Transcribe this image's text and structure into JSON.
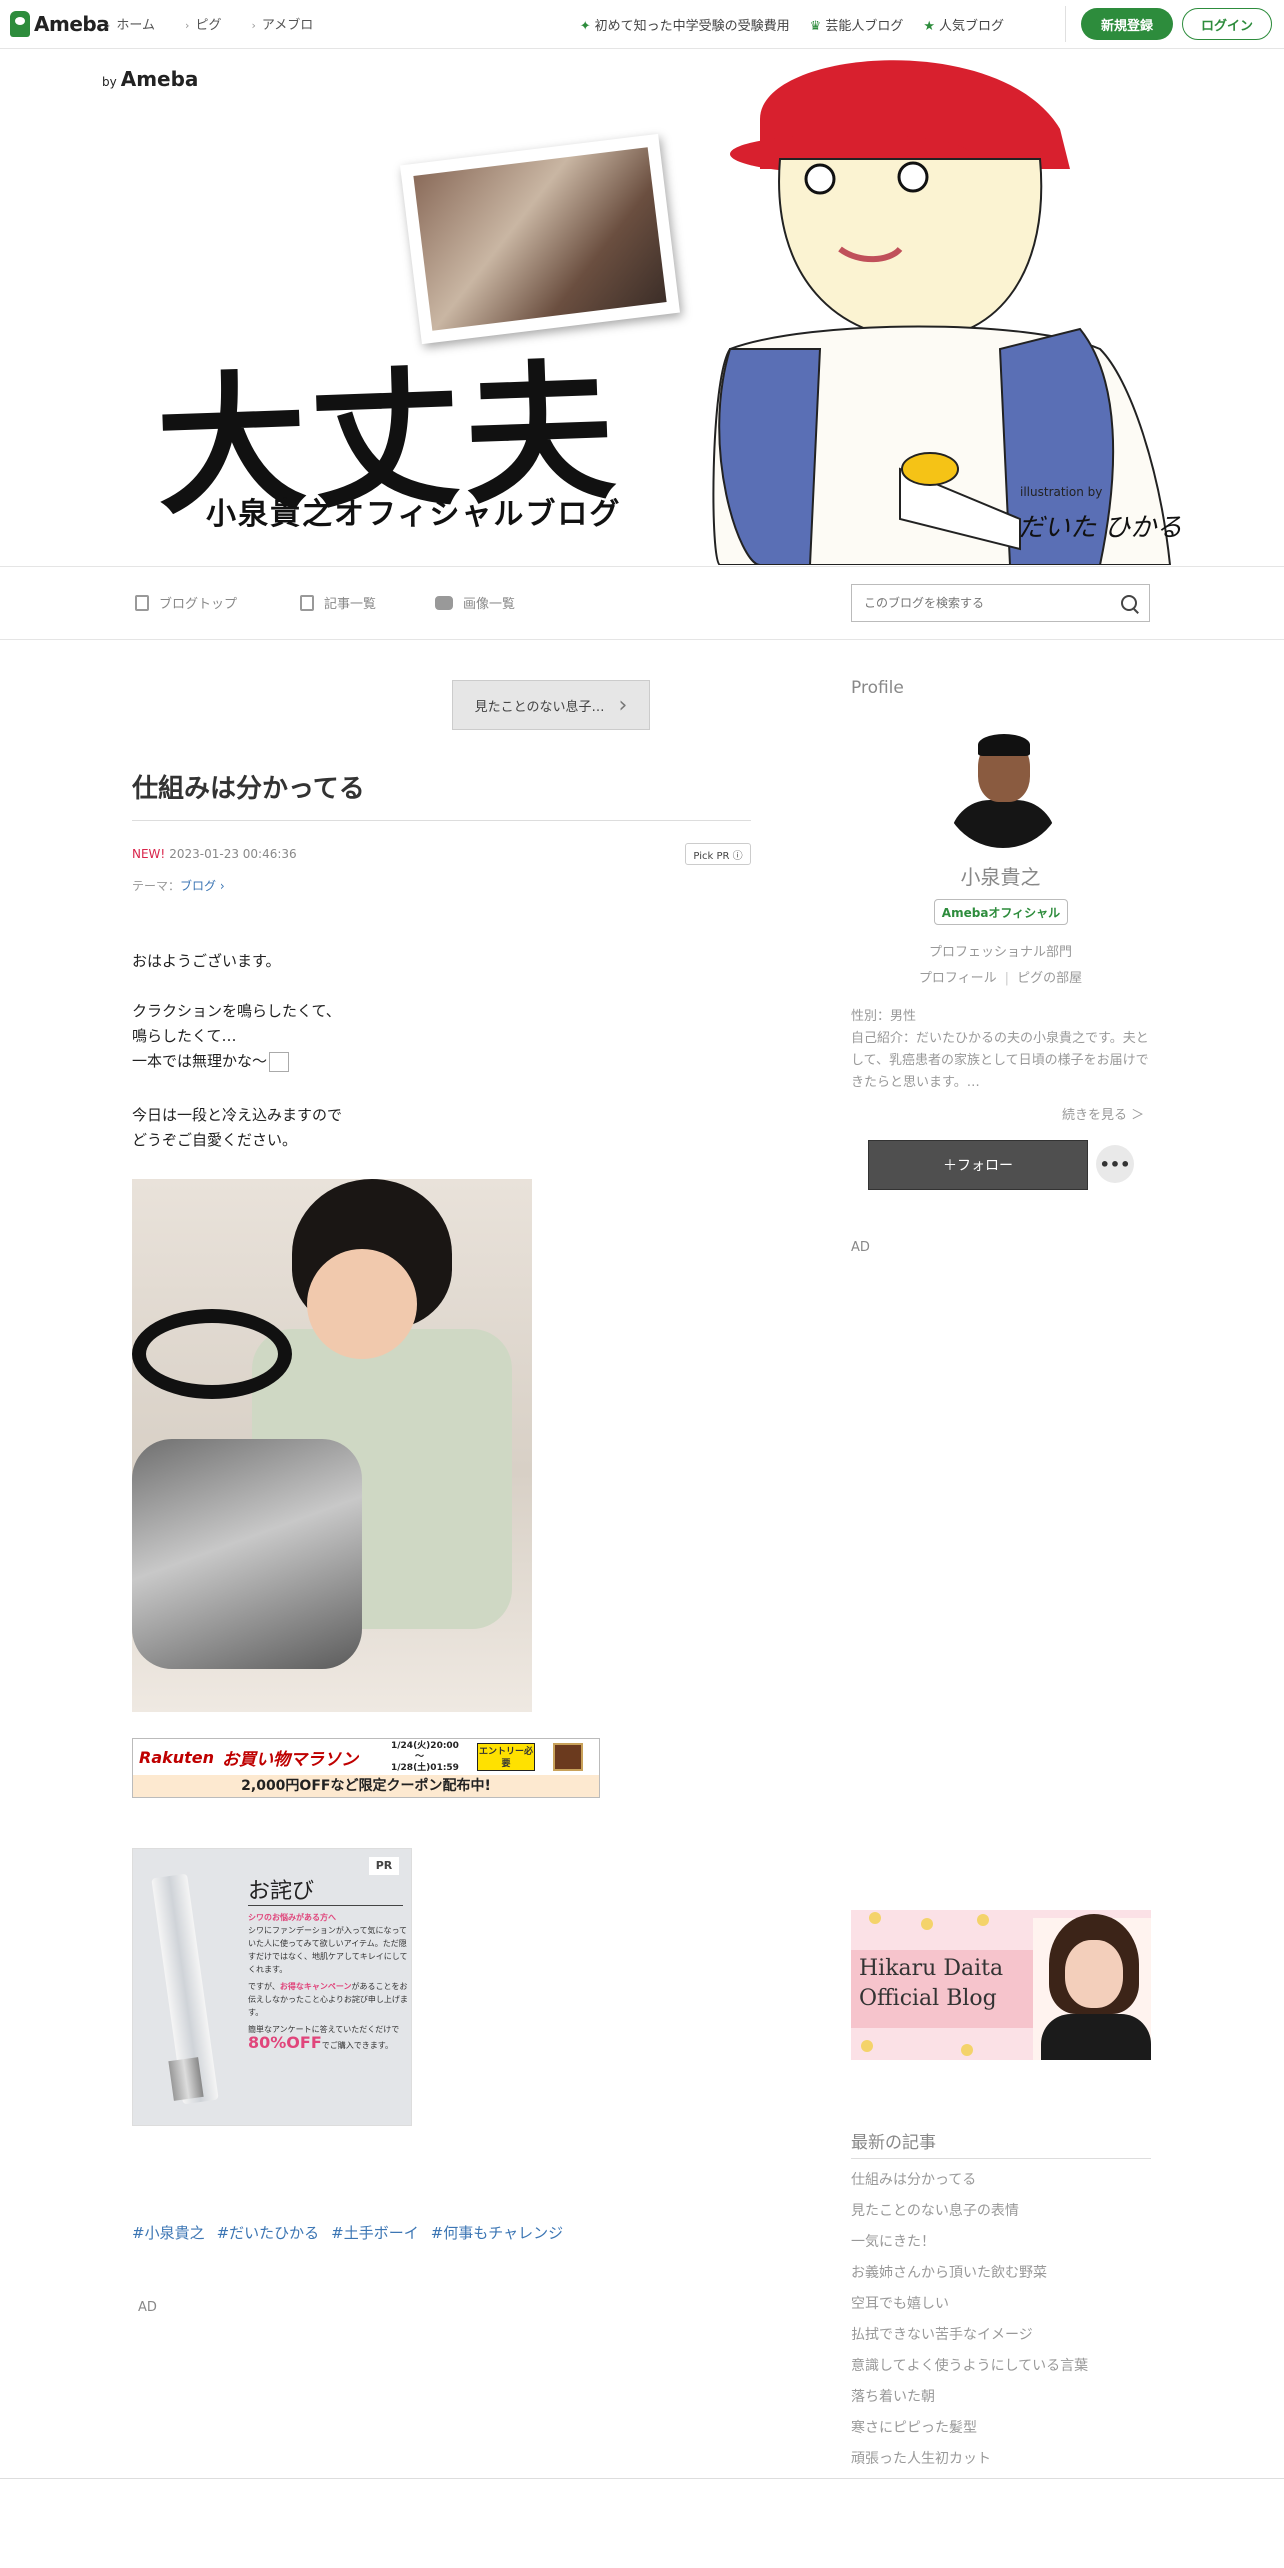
{
  "topnav": {
    "logo": "Ameba",
    "links": [
      "ホーム",
      "ピグ",
      "アメブロ"
    ],
    "right_links": [
      "初めて知った中学受験の受験費用",
      "芸能人ブログ",
      "人気ブログ"
    ],
    "register": "新規登録",
    "login": "ログイン"
  },
  "header": {
    "by": "by",
    "brand": "Ameba",
    "title": "大丈夫",
    "subtitle": "小泉貴之オフィシャルブログ",
    "illustration_credit": "illustration by",
    "illustrator": "だいた ひかる"
  },
  "subnav": {
    "items": [
      "ブログトップ",
      "記事一覧",
      "画像一覧"
    ],
    "search_placeholder": "このブログを検索する"
  },
  "article": {
    "prev_button": "見たことのない息子…",
    "title": "仕組みは分かってる",
    "new_label": "NEW!",
    "datetime": "2023-01-23 00:46:36",
    "pick_pr": "Pick PR ⓘ",
    "theme_label": "テーマ：",
    "theme_value": "ブログ",
    "paragraphs": [
      "おはようございます。",
      "クラクションを鳴らしたくて、",
      "鳴らしたくて…",
      "一本では無理かな〜",
      "今日は一段と冷え込みますので",
      "どうぞご自愛ください。"
    ],
    "hashtags": [
      "#小泉貴之",
      "#だいたひかる",
      "#土手ボーイ",
      "#何事もチャレンジ"
    ],
    "ad_label": "AD"
  },
  "rakuten_ad": {
    "logo": "Rakuten",
    "campaign": "お買い物マラソン",
    "date_start": "1/24(火)20:00",
    "date_sep": "〜",
    "date_end": "1/28(土)01:59",
    "entry": "エントリー必要",
    "offer": "2,000円OFFなど限定クーポン配布中!"
  },
  "pr_ad": {
    "badge": "PR",
    "title": "お詫び",
    "line1": "シワのお悩みがある方へ",
    "body": "シワにファンデーションが入って気になっていた人に使ってみて欲しいアイテム。ただ隠すだけではなく、地肌ケアしてキレイにしてくれます。",
    "line2a": "ですが、",
    "line2b": "お得なキャンペーン",
    "line2c": "があることをお伝えしなかったこと心よりお詫び申し上げます。",
    "line3": "簡単なアンケートに答えていただくだけで",
    "discount": "80%OFF",
    "line4": "でご購入できます。"
  },
  "sidebar": {
    "profile_heading": "Profile",
    "name": "小泉貴之",
    "official_badge": "Amebaオフィシャル",
    "department": "プロフェッショナル部門",
    "link_profile": "プロフィール",
    "link_pig": "ピグの部屋",
    "gender": "性別：男性",
    "intro": "自己紹介：だいたひかるの夫の小泉貴之です。夫として、乳癌患者の家族として日頃の様子をお届けできたらと思います。…",
    "more": "続きを見る ＞",
    "follow": "＋フォロー",
    "dots": "•••",
    "ad_label": "AD",
    "banner_title_1": "Hikaru Daita",
    "banner_title_2": "Official Blog",
    "recent_heading": "最新の記事",
    "recent": [
      "仕組みは分かってる",
      "見たことのない息子の表情",
      "一気にきた！",
      "お義姉さんから頂いた飲む野菜",
      "空耳でも嬉しい",
      "払拭できない苦手なイメージ",
      "意識してよく使うようにしている言葉",
      "落ち着いた朝",
      "寒さにピピった髪型",
      "頑張った人生初カット"
    ]
  },
  "colors": {
    "ameba_green": "#2d8c3c",
    "link_blue": "#3c76b4",
    "new_red": "#d9254b"
  }
}
